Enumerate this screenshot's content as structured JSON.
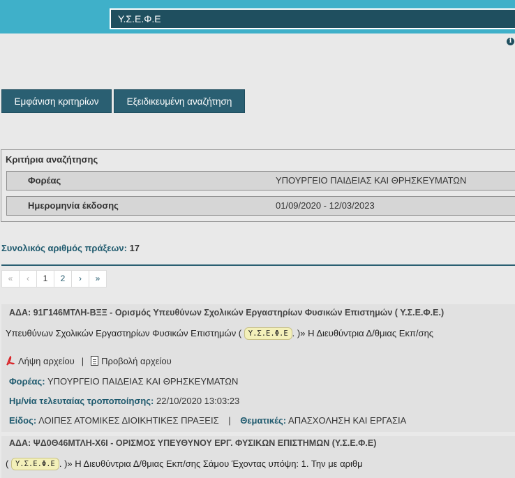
{
  "header": {
    "search_value": "Υ.Σ.Ε.Φ.Ε"
  },
  "buttons": {
    "show_criteria": "Εμφάνιση κριτηρίων",
    "advanced_search": "Εξειδικευμένη αναζήτηση"
  },
  "criteria": {
    "title": "Κριτήρια αναζήτησης",
    "rows": [
      {
        "label": "Φορέας",
        "value": "ΥΠΟΥΡΓΕΙΟ ΠΑΙΔΕΙΑΣ ΚΑΙ ΘΡΗΣΚΕΥΜΑΤΩΝ"
      },
      {
        "label": "Ημερομηνία έκδοσης",
        "value": "01/09/2020 - 12/03/2023"
      }
    ]
  },
  "results_summary": {
    "label": "Συνολικός αριθμός πράξεων:",
    "count": "17"
  },
  "pagination": {
    "first": "«",
    "prev": "‹",
    "pages": [
      "1",
      "2"
    ],
    "next": "›",
    "last": "»"
  },
  "results": [
    {
      "title": "ΑΔΑ: 91Γ146ΜΤΛΗ-ΒΞΞ - Ορισμός Υπευθύνων Σχολικών Εργαστηρίων Φυσικών Επιστημών ( Υ.Σ.Ε.Φ.Ε.)",
      "snippet_before": "Υπευθύνων Σχολικών Εργαστηρίων Φυσικών Επιστημών (",
      "snippet_highlight": "Υ.Σ.Ε.Φ.Ε",
      "snippet_after": ". )» Η Διευθύντρια Δ/θμιας Εκπ/σης",
      "download_label": "Λήψη αρχείου",
      "view_label": "Προβολή αρχείου",
      "organization_label": "Φορέας:",
      "organization_value": "ΥΠΟΥΡΓΕΙΟ ΠΑΙΔΕΙΑΣ ΚΑΙ ΘΡΗΣΚΕΥΜΑΤΩΝ",
      "modified_label": "Ημ/νία τελευταίας τροποποίησης:",
      "modified_value": "22/10/2020 13:03:23",
      "type_label": "Είδος:",
      "type_value": "ΛΟΙΠΕΣ ΑΤΟΜΙΚΕΣ ΔΙΟΙΚΗΤΙΚΕΣ ΠΡΑΞΕΙΣ",
      "topics_label": "Θεματικές:",
      "topics_value": "ΑΠΑΣΧΟΛΗΣΗ ΚΑΙ ΕΡΓΑΣΙΑ"
    },
    {
      "title": "ΑΔΑ: ΨΔ0Θ46ΜΤΛΗ-Χ6Ι - ΟΡΙΣΜΟΣ ΥΠΕΥΘΥΝΟΥ ΕΡΓ. ΦΥΣΙΚΩΝ ΕΠΙΣΤΗΜΩΝ (Υ.Σ.Ε.Φ.Ε)",
      "snippet_before": "(",
      "snippet_highlight": "Υ.Σ.Ε.Φ.Ε",
      "snippet_after": ". )» Η Διευθύντρια Δ/θμιας Εκπ/σης Σάμου Έχοντας υπόψη: 1. Την με αριθμ"
    }
  ],
  "colors": {
    "topbar": "#3fb0c9",
    "button": "#2a5f72",
    "highlight": "#f3f0b9"
  }
}
